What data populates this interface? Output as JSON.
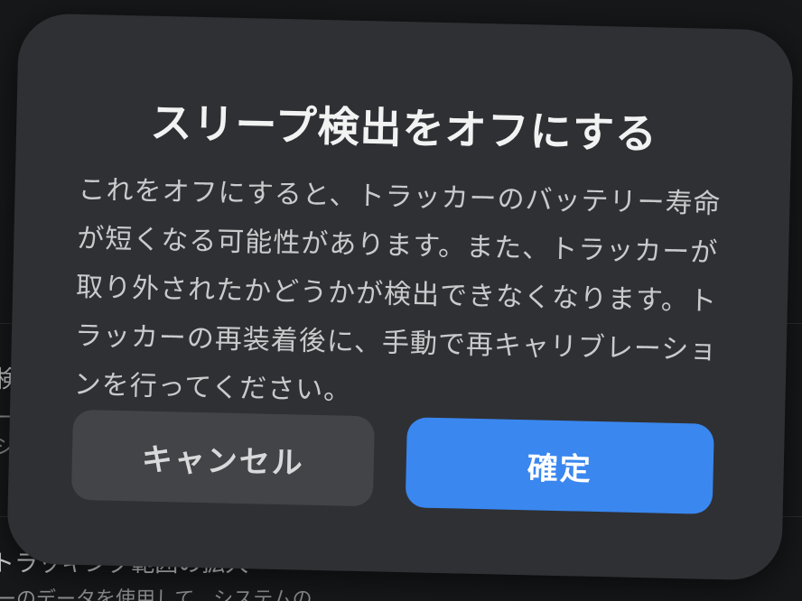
{
  "background": {
    "item_1_title": "トラッキング範囲の拡大",
    "item_1_sub": "ーのデータを使用して、システムの",
    "partial_left_1": "検出",
    "partial_left_2": "ー",
    "partial_left_3": "シ"
  },
  "dialog": {
    "title": "スリープ検出をオフにする",
    "message": "これをオフにすると、トラッカーのバッテリー寿命が短くなる可能性があります。また、トラッカーが取り外されたかどうかが検出できなくなります。トラッカーの再装着後に、手動で再キャリブレーションを行ってください。",
    "cancel_label": "キャンセル",
    "confirm_label": "確定"
  },
  "colors": {
    "dialog_bg": "#2f3033",
    "cancel_bg": "#434447",
    "confirm_bg": "#3a87f0",
    "text_primary": "#f2f2f3",
    "text_secondary": "#c9cacc"
  }
}
